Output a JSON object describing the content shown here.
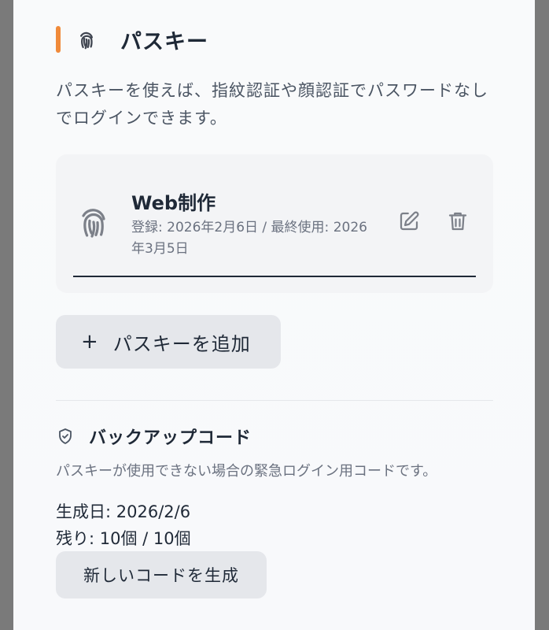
{
  "passkey_section": {
    "title": "パスキー",
    "description": "パスキーを使えば、指紋認証や顔認証でパスワードなしでログインできます。",
    "accent_color": "#f08a3a",
    "icon": "fingerprint-icon"
  },
  "passkeys": [
    {
      "name": "Web制作",
      "meta": "登録: 2026年2月6日 / 最終使用: 2026年3月5日",
      "icon": "fingerprint-icon",
      "actions": [
        "edit-icon",
        "trash-icon"
      ]
    }
  ],
  "add_passkey": {
    "icon": "+",
    "label": "パスキーを追加"
  },
  "backup": {
    "icon": "shield-check-icon",
    "title": "バックアップコード",
    "description": "パスキーが使用できない場合の緊急ログイン用コードです。",
    "generated": "生成日: 2026/2/6",
    "remaining": "残り: 10個 / 10個",
    "generate_label": "新しいコードを生成"
  }
}
